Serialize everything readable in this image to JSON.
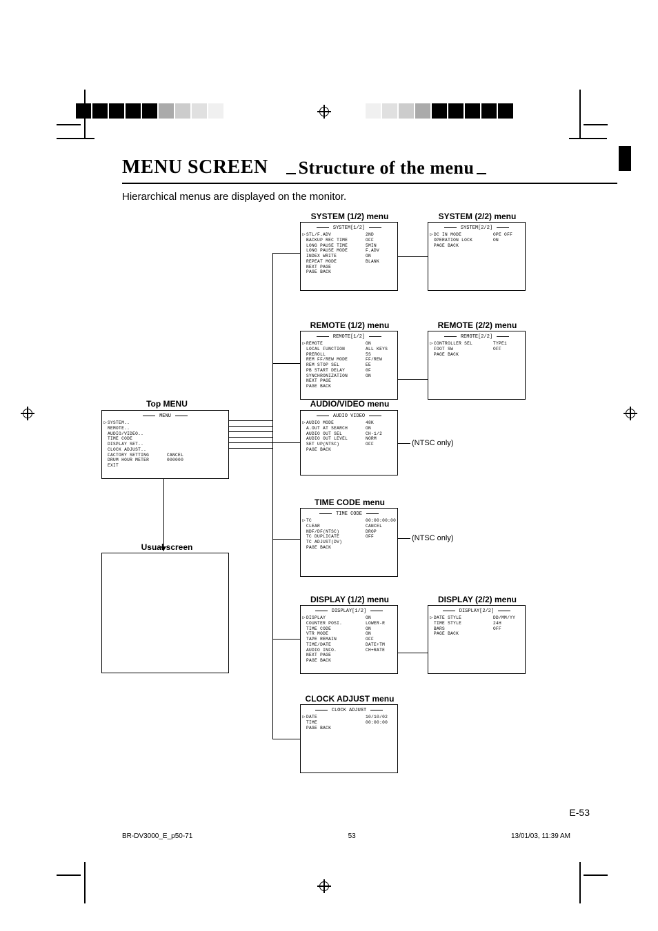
{
  "header": {
    "title_main": "MENU SCREEN",
    "title_sub": "Structure of the menu"
  },
  "intro": "Hierarchical menus are displayed on the monitor.",
  "labels": {
    "top_menu": "Top MENU",
    "usual_screen": "Usual screen",
    "system12": "SYSTEM (1/2) menu",
    "system22": "SYSTEM (2/2) menu",
    "remote12": "REMOTE (1/2) menu",
    "remote22": "REMOTE (2/2) menu",
    "audiovideo": "AUDIO/VIDEO menu",
    "timecode": "TIME CODE menu",
    "display12": "DISPLAY (1/2) menu",
    "display22": "DISPLAY (2/2) menu",
    "clockadjust": "CLOCK ADJUST menu",
    "ntsc_only": "(NTSC only)"
  },
  "menus": {
    "top": {
      "title": "MENU",
      "rows": [
        {
          "l": "SYSTEM..",
          "v": ""
        },
        {
          "l": "REMOTE..",
          "v": ""
        },
        {
          "l": "AUDIO/VIDEO..",
          "v": ""
        },
        {
          "l": "TIME CODE",
          "v": ""
        },
        {
          "l": "DISPLAY SET..",
          "v": ""
        },
        {
          "l": "CLOCK ADJUST..",
          "v": ""
        },
        {
          "l": "FACTORY SETTING",
          "v": "CANCEL"
        },
        {
          "l": "DRUM HOUR METER",
          "v": "000000"
        },
        {
          "l": "EXIT",
          "v": ""
        }
      ]
    },
    "system12": {
      "title": "SYSTEM[1/2]",
      "rows": [
        {
          "l": "STL/F.ADV",
          "v": "2ND"
        },
        {
          "l": "BACKUP REC TIME",
          "v": "OFF"
        },
        {
          "l": "LONG PAUSE TIME",
          "v": "5MIN"
        },
        {
          "l": "LONG PAUSE MODE",
          "v": "F.ADV"
        },
        {
          "l": "INDEX WRITE",
          "v": "ON"
        },
        {
          "l": "REPEAT MODE",
          "v": "BLANK"
        },
        {
          "l": "NEXT PAGE",
          "v": ""
        },
        {
          "l": "PAGE BACK",
          "v": ""
        }
      ]
    },
    "system22": {
      "title": "SYSTEM[2/2]",
      "rows": [
        {
          "l": "DC IN MODE",
          "v": "OPE OFF"
        },
        {
          "l": "OPERATION LOCK",
          "v": "ON"
        },
        {
          "l": "PAGE BACK",
          "v": ""
        }
      ]
    },
    "remote12": {
      "title": "REMOTE[1/2]",
      "rows": [
        {
          "l": "REMOTE",
          "v": "ON"
        },
        {
          "l": "LOCAL FUNCTION",
          "v": "ALL KEYS"
        },
        {
          "l": "PREROLL",
          "v": "5S"
        },
        {
          "l": "REM FF/REW MODE",
          "v": "FF/REW"
        },
        {
          "l": "REM STOP SEL",
          "v": "EE"
        },
        {
          "l": "PB START DELAY",
          "v": "0F"
        },
        {
          "l": "SYNCHRONIZATION",
          "v": "ON"
        },
        {
          "l": "NEXT PAGE",
          "v": ""
        },
        {
          "l": "PAGE BACK",
          "v": ""
        }
      ]
    },
    "remote22": {
      "title": "REMOTE[2/2]",
      "rows": [
        {
          "l": "CONTROLLER SEL",
          "v": "TYPE1"
        },
        {
          "l": "FOOT SW",
          "v": "OFF"
        },
        {
          "l": "PAGE BACK",
          "v": ""
        }
      ]
    },
    "audiovideo": {
      "title": "AUDIO VIDEO",
      "rows": [
        {
          "l": "AUDIO MODE",
          "v": "48K"
        },
        {
          "l": "A.OUT AT SEARCH",
          "v": "ON"
        },
        {
          "l": "AUDIO OUT SEL",
          "v": "CH-1/2"
        },
        {
          "l": "AUDIO OUT LEVEL",
          "v": "NORM"
        },
        {
          "l": "SET UP(NTSC)",
          "v": "OFF"
        },
        {
          "l": "PAGE BACK",
          "v": ""
        }
      ]
    },
    "timecode": {
      "title": "TIME CODE",
      "rows": [
        {
          "l": "TC",
          "v": "00:00:00:00"
        },
        {
          "l": "CLEAR",
          "v": "CANCEL"
        },
        {
          "l": "",
          "v": ""
        },
        {
          "l": "NDF/DF(NTSC)",
          "v": "DROP"
        },
        {
          "l": "TC DUPLICATE",
          "v": "OFF"
        },
        {
          "l": "TC ADJUST(DV)",
          "v": ""
        },
        {
          "l": "PAGE BACK",
          "v": ""
        }
      ]
    },
    "display12": {
      "title": "DISPLAY[1/2]",
      "rows": [
        {
          "l": "DISPLAY",
          "v": "ON"
        },
        {
          "l": "COUNTER POSI.",
          "v": "LOWER-R"
        },
        {
          "l": "TIME CODE",
          "v": "ON"
        },
        {
          "l": "VTR MODE",
          "v": "ON"
        },
        {
          "l": "TAPE REMAIN",
          "v": "OFF"
        },
        {
          "l": "TIME/DATE",
          "v": "DATE+TM"
        },
        {
          "l": "AUDIO INFO.",
          "v": "CH+RATE"
        },
        {
          "l": "NEXT PAGE",
          "v": ""
        },
        {
          "l": "PAGE BACK",
          "v": ""
        }
      ]
    },
    "display22": {
      "title": "DISPLAY[2/2]",
      "rows": [
        {
          "l": "DATE STYLE",
          "v": "DD/MM/YY"
        },
        {
          "l": "TIME STYLE",
          "v": "24H"
        },
        {
          "l": "BARS",
          "v": "OFF"
        },
        {
          "l": "PAGE BACK",
          "v": ""
        }
      ]
    },
    "clockadjust": {
      "title": "CLOCK ADJUST",
      "rows": [
        {
          "l": "DATE",
          "v": "10/10/02"
        },
        {
          "l": "TIME",
          "v": "00:00:00"
        },
        {
          "l": "PAGE BACK",
          "v": ""
        }
      ]
    }
  },
  "page_number": "E-53",
  "footer": {
    "file": "BR-DV3000_E_p50-71",
    "page": "53",
    "timestamp": "13/01/03, 11:39 AM"
  }
}
